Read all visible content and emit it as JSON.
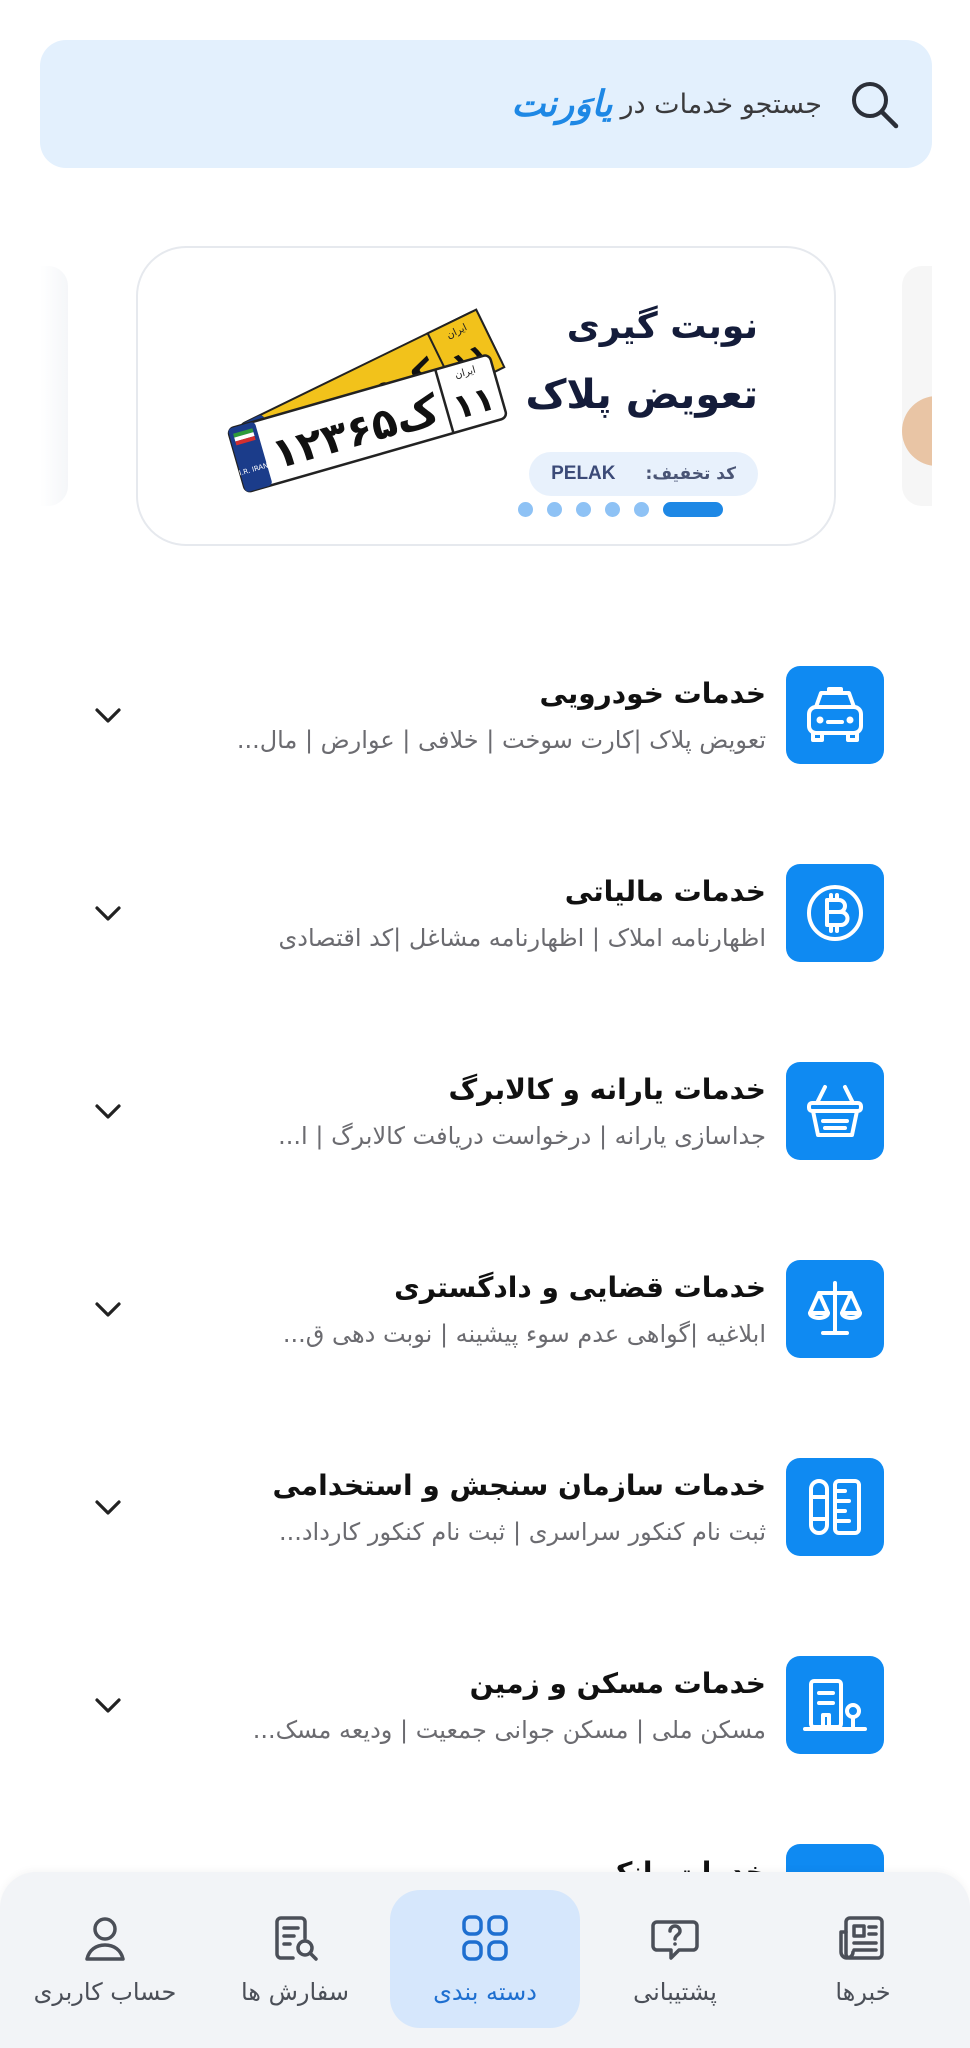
{
  "search": {
    "placeholder": "جستجو خدمات در",
    "brand": "یاوَرنت",
    "icon": "search-icon"
  },
  "banner": {
    "title_line1": "نوبت گیری",
    "title_line2": "تعویض پلاک",
    "promo_label": "کد تخفیف:",
    "promo_code": "PELAK",
    "plate_front_text": "۱۲ک۳۶۵",
    "plate_region": "۱۱",
    "plate_country": "ایران",
    "plate_ir_text": "I.R. IRAN",
    "slide_count": 6,
    "active_slide": 1
  },
  "categories": [
    {
      "title": "خدمات خودرویی",
      "subtitle": "تعویض پلاک |کارت سوخت | خلافی | عوارض | مال...",
      "icon": "car-icon"
    },
    {
      "title": "خدمات مالیاتی",
      "subtitle": "اظهارنامه املاک | اظهارنامه مشاغل |کد اقتصادی",
      "icon": "coin-icon"
    },
    {
      "title": "خدمات یارانه و کالابرگ",
      "subtitle": "جداسازی یارانه | درخواست دریافت کالابرگ | ا...",
      "icon": "basket-icon"
    },
    {
      "title": "خدمات قضایی و دادگستری",
      "subtitle": "ابلاغیه |گواهی عدم سوء پیشینه | نوبت دهی ق...",
      "icon": "scale-icon"
    },
    {
      "title": "خدمات سازمان سنجش و استخدامی",
      "subtitle": "ثبت نام کنکور سراسری | ثبت نام کنکور کارداد...",
      "icon": "exam-icon"
    },
    {
      "title": "خدمات مسکن و زمین",
      "subtitle": "مسکن ملی | مسکن جوانی جمعیت | ودیعه مسک...",
      "icon": "building-icon"
    }
  ],
  "partial_category": {
    "title": "خدمات بانکی",
    "icon": "bank-icon"
  },
  "bottom_nav": [
    {
      "label": "خبرها",
      "icon": "news-icon",
      "active": false
    },
    {
      "label": "پشتیبانی",
      "icon": "support-icon",
      "active": false
    },
    {
      "label": "دسته بندی",
      "icon": "grid-icon",
      "active": true
    },
    {
      "label": "سفارش ها",
      "icon": "orders-icon",
      "active": false
    },
    {
      "label": "حساب کاربری",
      "icon": "user-icon",
      "active": false
    }
  ],
  "colors": {
    "accent": "#1e88e5",
    "icon_tile": "#0f8af2",
    "search_bg": "#e3f0fd",
    "nav_active_bg": "#d6e7fc",
    "plate_yellow": "#f2c21b"
  }
}
